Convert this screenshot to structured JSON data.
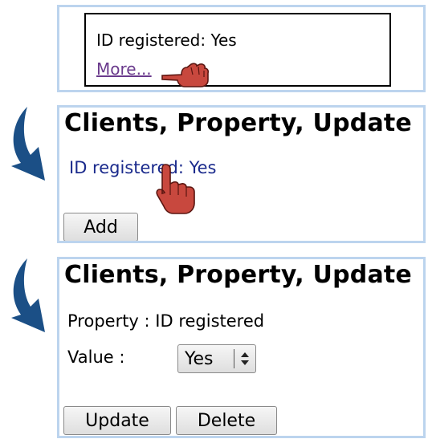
{
  "tooltip": {
    "text": "ID registered: Yes",
    "more_link": "More..."
  },
  "list_panel": {
    "heading": "Clients, Property, Update",
    "property_link": "ID registered: Yes",
    "add_button": "Add"
  },
  "edit_panel": {
    "heading": "Clients, Property, Update",
    "property_row": "Property : ID registered",
    "value_label": "Value :",
    "value_select": "Yes",
    "update_button": "Update",
    "delete_button": "Delete"
  },
  "colors": {
    "panel_border": "#bcd4ee",
    "arrow": "#1b4f86",
    "cursor": "#c8483e",
    "link": "#1a2a8c",
    "visited_link": "#6a3a8c"
  },
  "icons": {
    "step_arrow": "curved-down-right-arrow-icon",
    "cursor": "pointing-hand-cursor-icon",
    "select_arrows": "up-down-chevron-icon"
  }
}
